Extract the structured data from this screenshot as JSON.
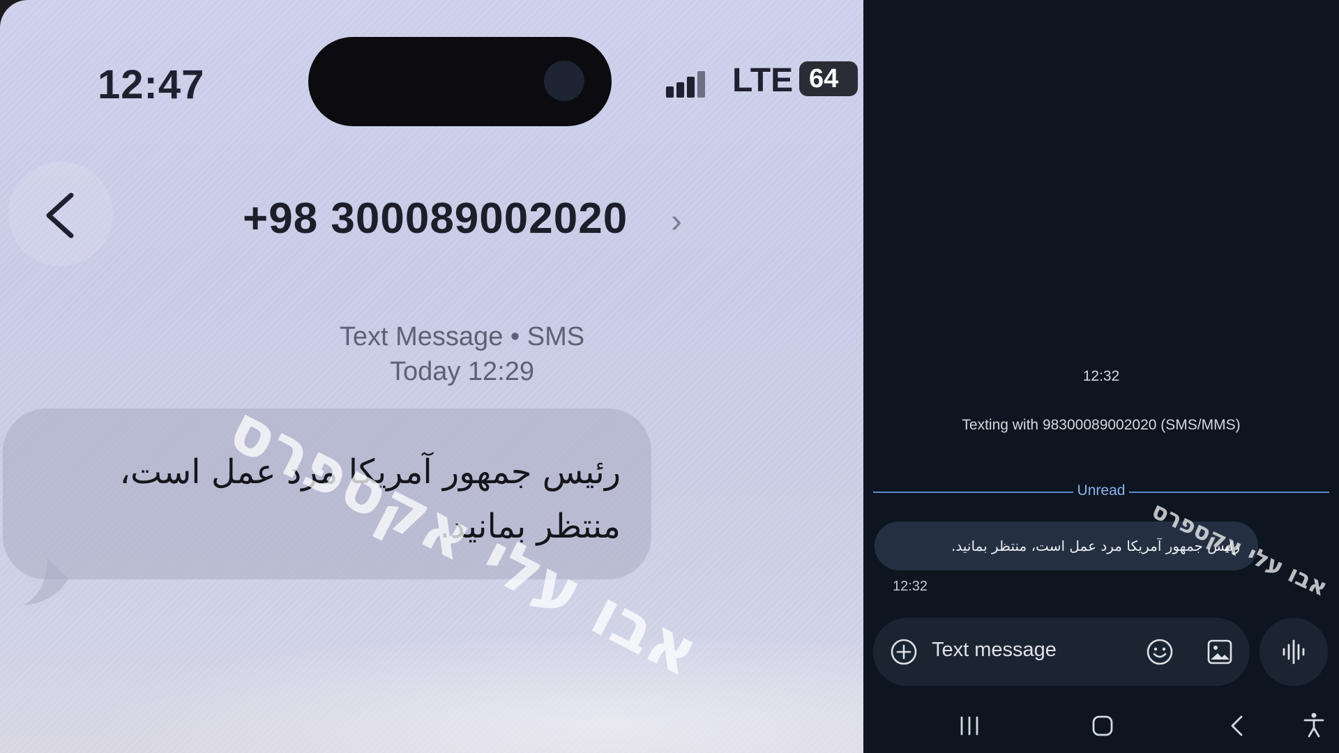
{
  "iphone": {
    "status_bar": {
      "time": "12:47",
      "network": "LTE",
      "battery": "64"
    },
    "header": {
      "contact": "+98 300089002020",
      "chevron": "›"
    },
    "message_meta": {
      "type": "Text Message • SMS",
      "date": "Today 12:29"
    },
    "message_text": "رئیس جمهور آمریکا مرد عمل است، منتظر بمانید.",
    "watermark": "אבו עלי אקספרס"
  },
  "android": {
    "time_top": "12:32",
    "texting_with": "Texting with 98300089002020 (SMS/MMS)",
    "unread_label": "Unread",
    "message_text": "رئیس جمهور آمریکا مرد عمل است، منتظر بمانید.",
    "message_time": "12:32",
    "input_placeholder": "Text message",
    "watermark": "אבו עלי אקספרס",
    "icons": [
      "plus-icon",
      "emoji-icon",
      "image-icon",
      "voice-icon",
      "recents-icon",
      "home-icon",
      "back-icon",
      "accessibility-icon"
    ]
  },
  "colors": {
    "android_bg": "#0d1520",
    "unread_accent": "#8fb3ec",
    "bubble_dark": "#243042"
  }
}
